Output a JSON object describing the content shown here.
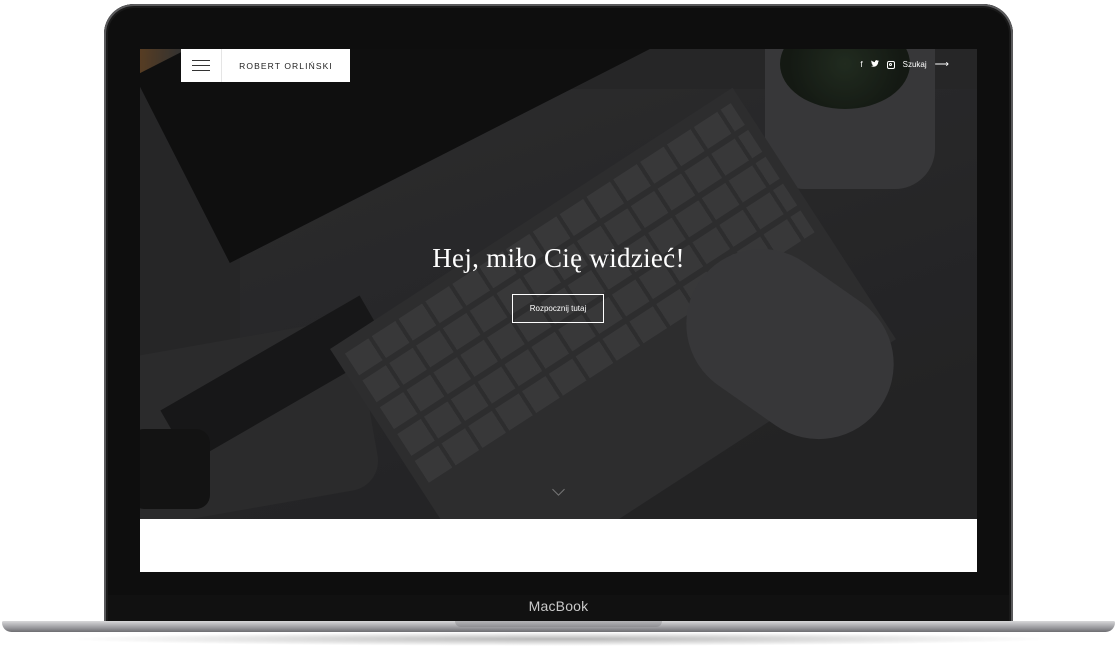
{
  "device": {
    "brand_label": "MacBook"
  },
  "header": {
    "logo_text": "ROBERT ORLIŃSKI",
    "search_label": "Szukaj",
    "social_icons": [
      "facebook-icon",
      "twitter-icon",
      "instagram-icon"
    ]
  },
  "hero": {
    "headline": "Hej, miło Cię widzieć!",
    "cta_label": "Rozpocznij tutaj"
  }
}
